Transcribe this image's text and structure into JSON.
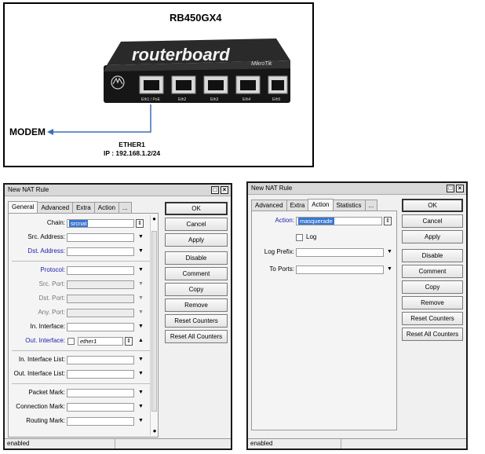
{
  "diagram": {
    "title": "RB450GX4",
    "modem": "MODEM",
    "ether_name": "ETHER1",
    "ether_ip": "IP : 192.168.1.2/24",
    "brand": "routerboard",
    "brand_sub": "MikroTik",
    "ports": [
      "Eth1 / PoE",
      "Eth2",
      "Eth3",
      "Eth4",
      "Eth5"
    ]
  },
  "left_window": {
    "title": "New NAT Rule",
    "tabs": [
      "General",
      "Advanced",
      "Extra",
      "Action",
      "..."
    ],
    "active_tab": "General",
    "fields": [
      {
        "label": "Chain:",
        "value": "srcnat"
      },
      {
        "label": "Src. Address:",
        "value": ""
      },
      {
        "label": "Dst. Address:",
        "value": ""
      },
      {
        "label": "Protocol:",
        "value": ""
      },
      {
        "label": "Src. Port:",
        "value": ""
      },
      {
        "label": "Dst. Port:",
        "value": ""
      },
      {
        "label": "Any. Port:",
        "value": ""
      },
      {
        "label": "In. Interface:",
        "value": ""
      },
      {
        "label": "Out. Interface:",
        "value": "ether1"
      },
      {
        "label": "In. Interface List:",
        "value": ""
      },
      {
        "label": "Out. Interface List:",
        "value": ""
      },
      {
        "label": "Packet Mark:",
        "value": ""
      },
      {
        "label": "Connection Mark:",
        "value": ""
      },
      {
        "label": "Routing Mark:",
        "value": ""
      }
    ],
    "buttons": [
      "OK",
      "Cancel",
      "Apply",
      "Disable",
      "Comment",
      "Copy",
      "Remove",
      "Reset Counters",
      "Reset All Counters"
    ],
    "status": "enabled"
  },
  "right_window": {
    "title": "New NAT Rule",
    "tabs": [
      "Advanced",
      "Extra",
      "Action",
      "Statistics",
      "..."
    ],
    "active_tab": "Action",
    "action_label": "Action:",
    "action_value": "masquerade",
    "log_label": "Log",
    "log_prefix_label": "Log Prefix:",
    "to_ports_label": "To Ports:",
    "buttons": [
      "OK",
      "Cancel",
      "Apply",
      "Disable",
      "Comment",
      "Copy",
      "Remove",
      "Reset Counters",
      "Reset All Counters"
    ],
    "status": "enabled"
  },
  "colors": {
    "label_blue": "#1b1bb0",
    "selection": "#3a76d0",
    "router_body": "#1a1a1a",
    "connector": "#3d6fb4"
  }
}
